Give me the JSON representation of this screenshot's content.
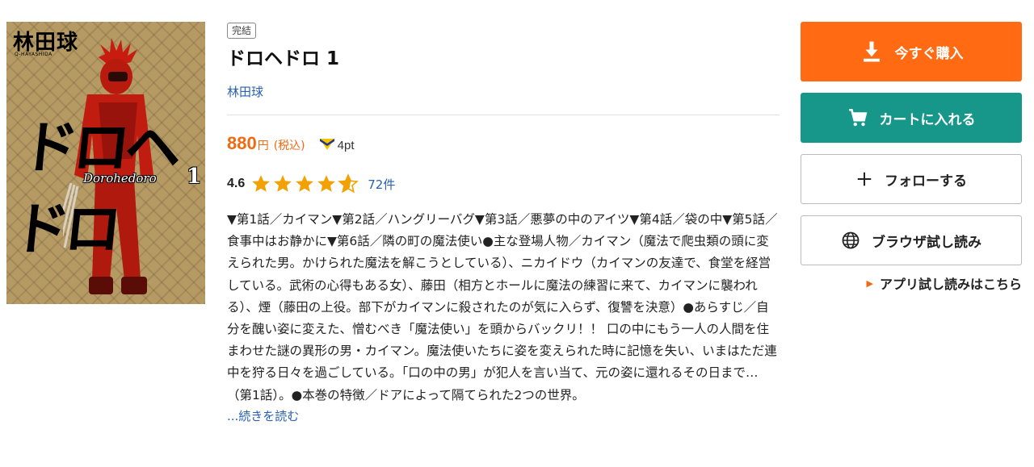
{
  "cover": {
    "author_jp": "林田球",
    "author_romaji": "Q-HAYASHIDA",
    "logo": "ドロヘドロ",
    "subtitle": "Dorohedoro",
    "volume": "1"
  },
  "product": {
    "status_badge": "完結",
    "title": "ドロヘドロ 1",
    "author": "林田球",
    "price": "880",
    "price_unit": "円",
    "tax_label": "(税込)",
    "points": "4pt",
    "rating": "4.6",
    "rating_value": 4.6,
    "review_count": "72件",
    "description": "▼第1話／カイマン▼第2話／ハングリーバグ▼第3話／悪夢の中のアイツ▼第4話／袋の中▼第5話／食事中はお静かに▼第6話／隣の町の魔法使い●主な登場人物／カイマン（魔法で爬虫類の頭に変えられた男。かけられた魔法を解こうとしている）、ニカイドウ（カイマンの友達で、食堂を経営している。武術の心得もある女）、藤田（相方とホールに魔法の練習に来て、カイマンに襲われる）、煙（藤田の上役。部下がカイマンに殺されたのが気に入らず、復讐を決意）●あらすじ／自分を醜い姿に変えた、憎むべき「魔法使い」を頭からバックリ！！ 口の中にもう一人の人間を住まわせた謎の異形の男・カイマン。魔法使いたちに姿を変えられた時に記憶を失い、いまはただ連中を狩る日々を過ごしている。「口の中の男」が犯人を言い当て、元の姿に還れるその日まで…（第1話）。●本巻の特徴／ドアによって隔てられた2つの世界。",
    "read_more": "...続きを読む"
  },
  "actions": {
    "buy": "今すぐ購入",
    "cart": "カートに入れる",
    "follow": "フォローする",
    "browser_read": "ブラウザ試し読み",
    "app_read": "アプリ試し読みはこちら"
  },
  "colors": {
    "accent_orange": "#ff6a13",
    "cart_teal": "#17968a",
    "link_blue": "#2860b4",
    "star": "#f2a100"
  },
  "icons": [
    "download-icon",
    "cart-icon",
    "plus-icon",
    "globe-icon",
    "triangle-right-icon",
    "star-icon",
    "point-icon"
  ]
}
